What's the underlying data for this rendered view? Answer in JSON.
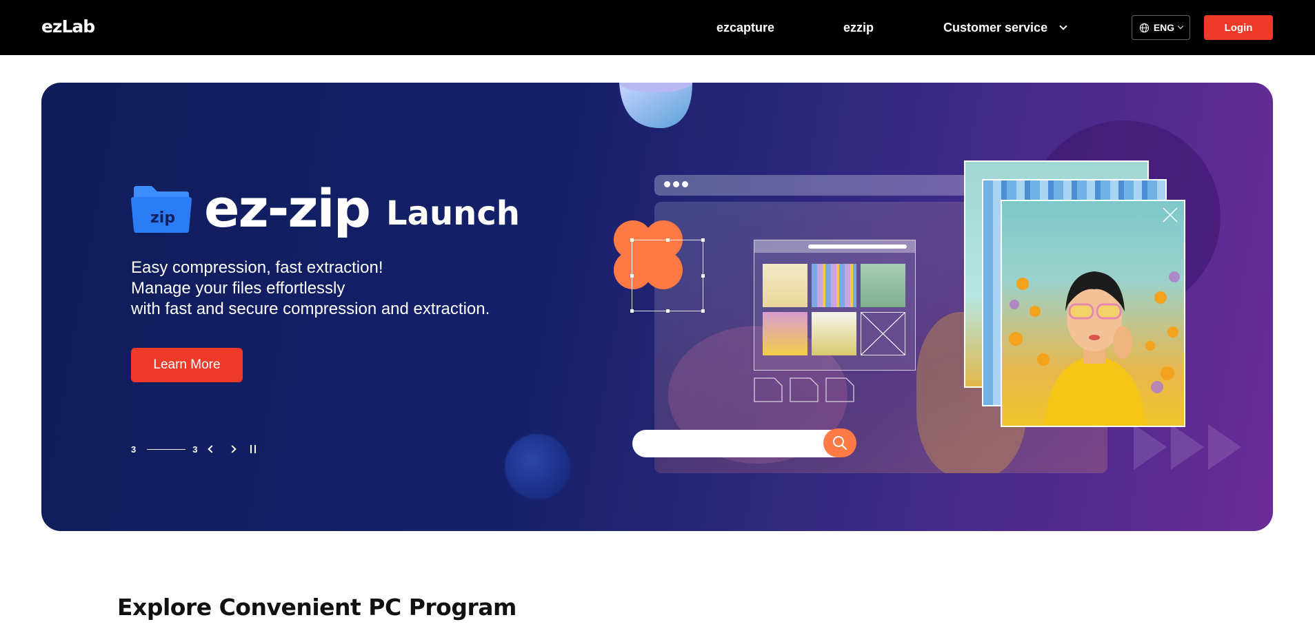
{
  "header": {
    "logo": "ezLab",
    "nav": [
      {
        "label": "ezcapture"
      },
      {
        "label": "ezzip"
      },
      {
        "label": "Customer service"
      }
    ],
    "language": "ENG",
    "login_label": "Login"
  },
  "hero": {
    "folder_label": "zip",
    "brand_name": "ez-zip",
    "brand_suffix": "Launch",
    "tagline": [
      "Easy compression, fast extraction!",
      "Manage your files effortlessly",
      "with fast and secure compression and extraction."
    ],
    "cta_label": "Learn More",
    "pager": {
      "current": "3",
      "total": "3"
    }
  },
  "section": {
    "title": "Explore Convenient PC Program"
  },
  "colors": {
    "accent": "#ef3a2a",
    "nav_bg": "#000000",
    "hero_start": "#101d5a",
    "hero_end": "#6a2b98",
    "search_btn": "#ff7a45"
  },
  "icons": [
    "globe-icon",
    "chevron-down-icon",
    "chevron-left-icon",
    "chevron-right-icon",
    "pause-icon",
    "search-icon",
    "close-icon",
    "zip-folder-icon"
  ]
}
